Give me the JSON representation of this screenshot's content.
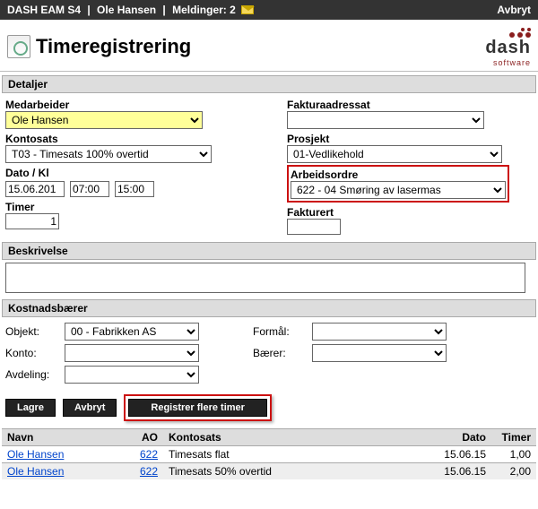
{
  "topbar": {
    "app": "DASH EAM S4",
    "user": "Ole Hansen",
    "messages_label": "Meldinger: 2",
    "cancel": "Avbryt"
  },
  "page": {
    "title": "Timeregistrering"
  },
  "logo": {
    "brand": "dash",
    "sub": "software"
  },
  "sections": {
    "detaljer": "Detaljer",
    "beskrivelse": "Beskrivelse",
    "kostnad": "Kostnadsbærer"
  },
  "fields": {
    "medarbeider_label": "Medarbeider",
    "medarbeider_value": "Ole Hansen",
    "kontosats_label": "Kontosats",
    "kontosats_value": "T03 - Timesats 100% overtid",
    "dato_label": "Dato / Kl",
    "dato_value": "15.06.201",
    "kl_from": "07:00",
    "kl_to": "15:00",
    "timer_label": "Timer",
    "timer_value": "1",
    "fakturaadressat_label": "Fakturaadressat",
    "fakturaadressat_value": "",
    "prosjekt_label": "Prosjekt",
    "prosjekt_value": "01-Vedlikehold",
    "arbeidsordre_label": "Arbeidsordre",
    "arbeidsordre_value": "622 - 04 Smøring av lasermas",
    "fakturert_label": "Fakturert",
    "fakturert_value": "",
    "beskrivelse_value": ""
  },
  "cost": {
    "objekt_label": "Objekt:",
    "objekt_value": "00 - Fabrikken AS",
    "konto_label": "Konto:",
    "konto_value": "",
    "avdeling_label": "Avdeling:",
    "avdeling_value": "",
    "formal_label": "Formål:",
    "formal_value": "",
    "baerer_label": "Bærer:",
    "baerer_value": ""
  },
  "buttons": {
    "lagre": "Lagre",
    "avbryt": "Avbryt",
    "registrer": "Registrer flere timer"
  },
  "table": {
    "headers": {
      "navn": "Navn",
      "ao": "AO",
      "kontosats": "Kontosats",
      "dato": "Dato",
      "timer": "Timer"
    },
    "rows": [
      {
        "navn": "Ole Hansen",
        "ao": "622",
        "kontosats": "Timesats flat",
        "dato": "15.06.15",
        "timer": "1,00"
      },
      {
        "navn": "Ole Hansen",
        "ao": "622",
        "kontosats": "Timesats 50% overtid",
        "dato": "15.06.15",
        "timer": "2,00"
      }
    ]
  }
}
